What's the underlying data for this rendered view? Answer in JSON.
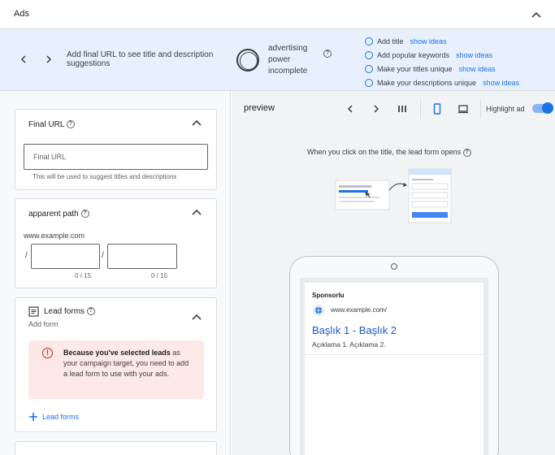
{
  "header": {
    "title": "Ads"
  },
  "strength": {
    "message": "Add final URL to see title and description suggestions",
    "power_line1": "advertising",
    "power_line2": "power",
    "power_status": "incomplete",
    "ideas": [
      {
        "label": "Add title",
        "link": "show ideas"
      },
      {
        "label": "Add popular keywords",
        "link": "show ideas"
      },
      {
        "label": "Make your titles unique",
        "link": "show ideas"
      },
      {
        "label": "Make your descriptions unique",
        "link": "show ideas"
      }
    ]
  },
  "final_url": {
    "title": "Final URL",
    "placeholder": "Final URL",
    "hint": "This will be used to suggest titles and descriptions"
  },
  "apparent_path": {
    "title": "apparent path",
    "domain": "www.example.com",
    "slash": "/",
    "counter1": "0 / 15",
    "counter2": "0 / 15"
  },
  "lead_forms": {
    "title": "Lead forms",
    "subtitle": "Add form",
    "alert_bold": "Because you've selected leads",
    "alert_rest": " as your campaign target, you need to add a lead form to use with your ads.",
    "add_link": "Lead forms"
  },
  "preview": {
    "title": "preview",
    "highlight_label": "Highlight ad",
    "lead_message": "When you click on the title, the lead form opens",
    "ad": {
      "sponsored": "Sponsorlu",
      "url": "www.example.com/",
      "headline": "Başlık 1 - Başlık 2",
      "description": "Açıklama 1. Açıklama 2."
    }
  },
  "colors": {
    "accent": "#1a73e8",
    "strength_bg": "#e8f0fe",
    "alert_bg": "#fce8e6",
    "alert_icon": "#c5221f"
  },
  "icons": [
    "chevron-up-icon",
    "chevron-left-icon",
    "chevron-right-icon",
    "help-icon",
    "columns-icon",
    "mobile-icon",
    "desktop-icon",
    "error-icon",
    "form-icon",
    "globe-icon",
    "plus-icon"
  ]
}
